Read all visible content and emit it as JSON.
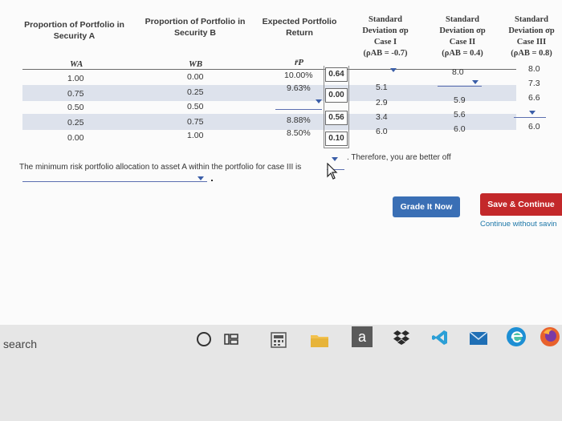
{
  "table": {
    "headers": [
      "Proportion of Portfolio in\nSecurity A",
      "Proportion of Portfolio in\nSecurity B",
      "Expected Portfolio\nReturn",
      "Standard\nDeviation σp\nCase I\n(ρAB = -0.7)",
      "Standard\nDeviation σp\nCase II\n(ρAB = 0.4)",
      "Standard\nDeviation σp\nCase III\n(ρAB = 0.8)"
    ],
    "symbols": [
      "WA",
      "WB",
      "r̄P"
    ],
    "wa": [
      "1.00",
      "0.75",
      "0.50",
      "0.25",
      "0.00"
    ],
    "wb": [
      "0.00",
      "0.25",
      "0.50",
      "0.75",
      "1.00"
    ],
    "ret": [
      "10.00%",
      "9.63%",
      "",
      "8.88%",
      "8.50%"
    ],
    "answer_boxes": [
      "0.64",
      "0.00",
      "0.56",
      "0.10"
    ],
    "case1": [
      "5.1",
      "2.9",
      "3.4",
      "6.0"
    ],
    "case2": [
      "8.0",
      "5.9",
      "5.6",
      "6.0"
    ],
    "case3": [
      "8.0",
      "7.3",
      "6.6",
      "6.0"
    ]
  },
  "question": {
    "text": "The minimum risk portfolio allocation to asset A within the portfolio for case III is",
    "after": ". Therefore, you are better off"
  },
  "buttons": {
    "grade": "Grade It Now",
    "save": "Save & Continue",
    "continue_link": "Continue without savin"
  },
  "taskbar": {
    "search": "search",
    "store_letter": "a"
  },
  "colors": {
    "band": "#dde2ec",
    "grade_button": "#3a6fb5",
    "save_button": "#c3282a",
    "dropdown_arrow": "#3b5ea8"
  }
}
